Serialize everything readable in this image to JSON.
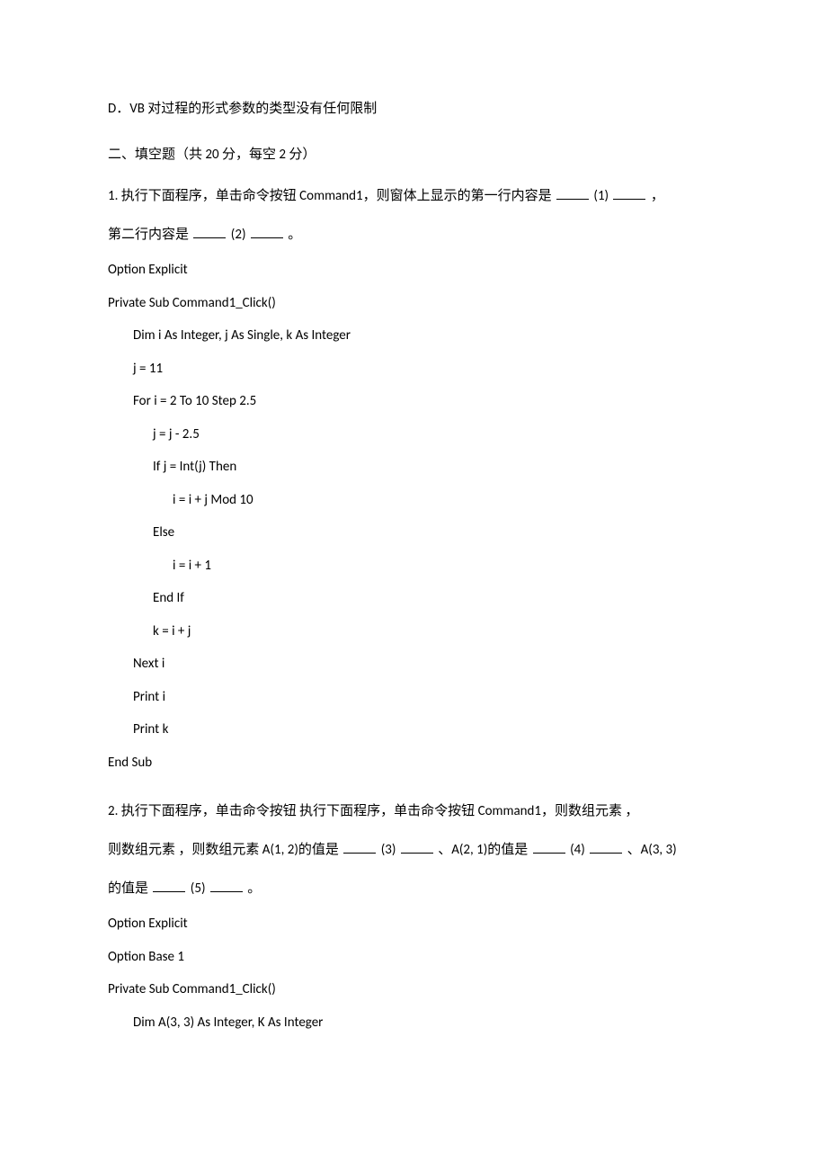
{
  "optionD": "D．VB  对过程的形式参数的类型没有任何限制",
  "section2": "二、填空题（共 20 分，每空 2 分）",
  "q1": {
    "intro_a": "1. 执行下面程序，单击命令按钮 Command1，则窗体上显示的第一行内容是 ",
    "blank1_label": " (1) ",
    "intro_b": " ，",
    "line2_a": "第二行内容是 ",
    "blank2_label": " (2) ",
    "line2_b": " 。",
    "code": {
      "l1": "Option Explicit",
      "l2": "Private Sub Command1_Click()",
      "l3": "Dim i As Integer, j As Single, k As Integer",
      "l4": "j = 11",
      "l5": "For i = 2 To 10 Step 2.5",
      "l6": "j = j - 2.5",
      "l7": "If j = Int(j) Then",
      "l8": "i = i + j Mod 10",
      "l9": "Else",
      "l10": "i = i + 1",
      "l11": "End If",
      "l12": "k = i + j",
      "l13": "Next i",
      "l14": "Print i",
      "l15": "Print k",
      "l16": "End Sub"
    }
  },
  "q2": {
    "intro_a": "2. 执行下面程序，单击命令按钮 执行下面程序，单击命令按钮 Command1，则数组元素 ，",
    "line2_a": "则数组元素 ，则数组元素 A(1, 2)的值是 ",
    "blank3_label": " (3) ",
    "mid_a": " 、A(2, 1)的值是 ",
    "blank4_label": " (4) ",
    "mid_b": " 、A(3, 3)",
    "line3_a": "的值是 ",
    "blank5_label": " (5) ",
    "line3_b": " 。",
    "code": {
      "l1": "Option Explicit",
      "l2": "Option Base 1",
      "l3": "Private Sub Command1_Click()",
      "l4": "Dim A(3, 3) As Integer, K As Integer"
    }
  }
}
